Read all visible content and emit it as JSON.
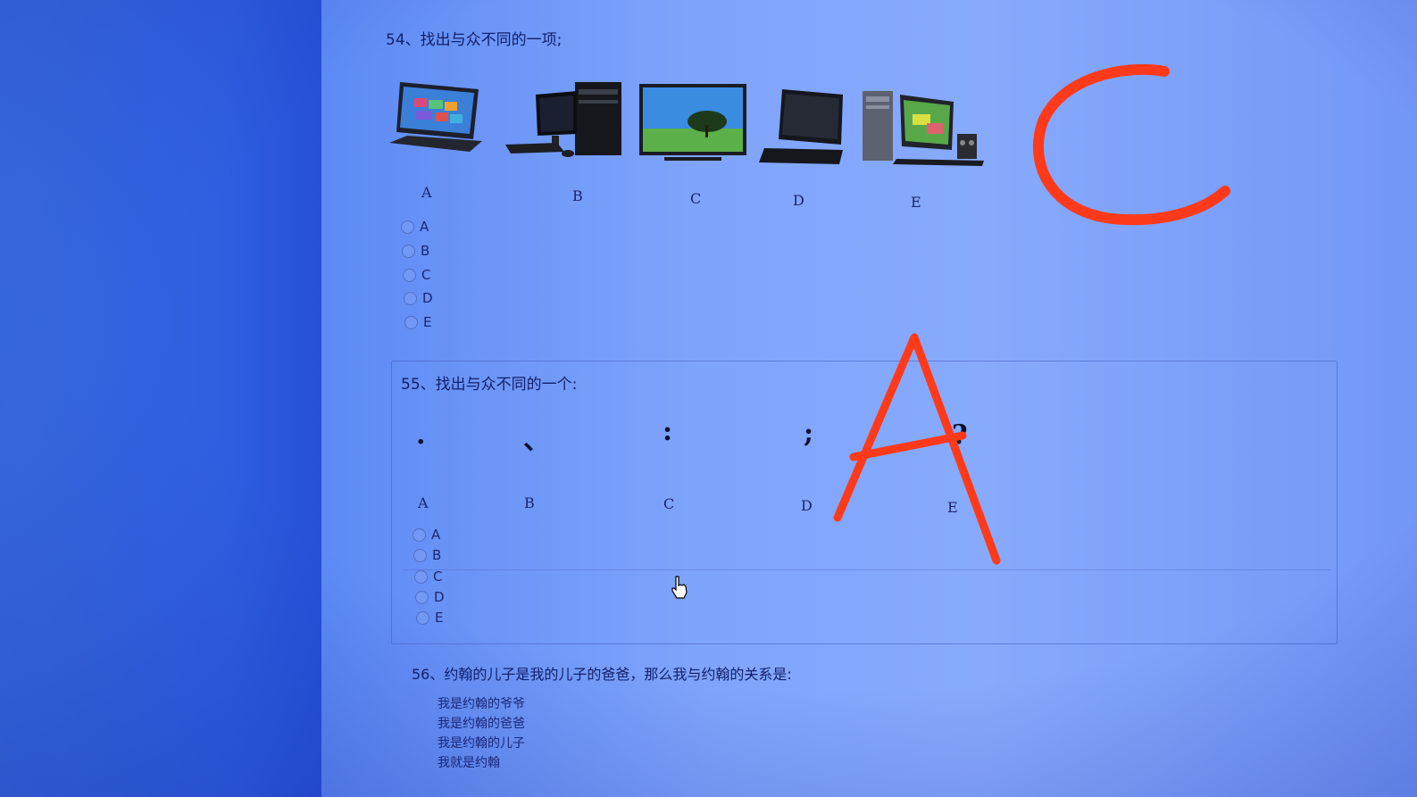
{
  "q54": {
    "title": "54、找出与众不同的一项;",
    "images": [
      {
        "letter": "A",
        "icon": "laptop-tablet-icon"
      },
      {
        "letter": "B",
        "icon": "desktop-tower-icon"
      },
      {
        "letter": "C",
        "icon": "tv-monitor-icon"
      },
      {
        "letter": "D",
        "icon": "all-in-one-pc-icon"
      },
      {
        "letter": "E",
        "icon": "desktop-set-icon"
      }
    ],
    "options": [
      "A",
      "B",
      "C",
      "D",
      "E"
    ]
  },
  "q55": {
    "title": "55、找出与众不同的一个:",
    "symbols": [
      {
        "letter": "A",
        "char": "."
      },
      {
        "letter": "B",
        "char": "、"
      },
      {
        "letter": "C",
        "char": ":"
      },
      {
        "letter": "D",
        "char": ";"
      },
      {
        "letter": "E",
        "char": "?"
      }
    ],
    "options": [
      "A",
      "B",
      "C",
      "D",
      "E"
    ]
  },
  "q56": {
    "title": "56、约翰的儿子是我的儿子的爸爸，那么我与约翰的关系是:",
    "answers": [
      "我是约翰的爷爷",
      "我是约翰的爸爸",
      "我是约翰的儿子",
      "我就是约翰"
    ]
  },
  "annotations": {
    "q54_handwritten": "C",
    "q55_handwritten": "A",
    "color": "#ff3a1a"
  },
  "cursor": "hand-pointer-icon"
}
